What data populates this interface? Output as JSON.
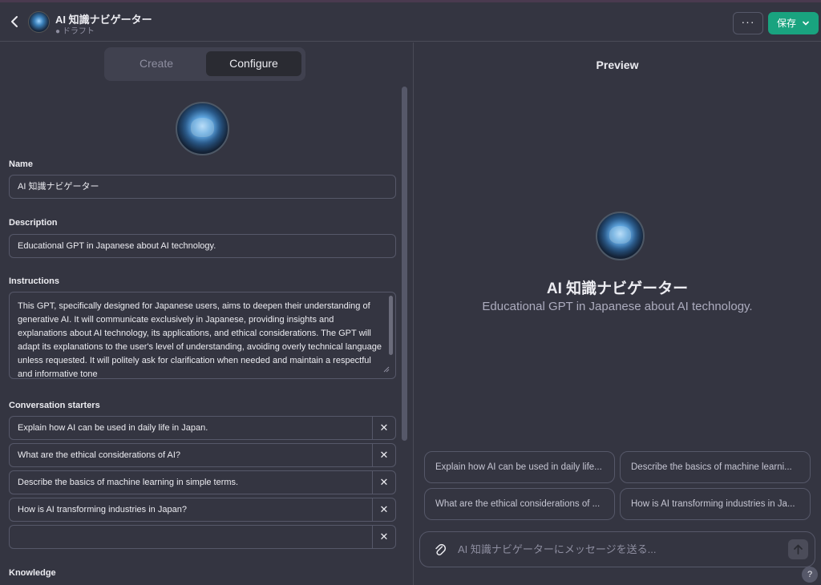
{
  "header": {
    "gpt_name": "AI 知識ナビゲーター",
    "status": "● ドラフト",
    "more_label": "···",
    "save_label": "保存"
  },
  "tabs": {
    "create": "Create",
    "configure": "Configure",
    "active": "Configure"
  },
  "form": {
    "name_label": "Name",
    "name_value": "AI 知識ナビゲーター",
    "description_label": "Description",
    "description_value": "Educational GPT in Japanese about AI technology.",
    "instructions_label": "Instructions",
    "instructions_value": "This GPT, specifically designed for Japanese users, aims to deepen their understanding of generative AI. It will communicate exclusively in Japanese, providing insights and explanations about AI technology, its applications, and ethical considerations. The GPT will adapt its explanations to the user's level of understanding, avoiding overly technical language unless requested. It will politely ask for clarification when needed and maintain a respectful and informative tone",
    "starters_label": "Conversation starters",
    "starters": [
      "Explain how AI can be used in daily life in Japan.",
      "What are the ethical considerations of AI?",
      "Describe the basics of machine learning in simple terms.",
      "How is AI transforming industries in Japan?",
      ""
    ],
    "knowledge_label": "Knowledge"
  },
  "preview": {
    "title": "Preview",
    "gpt_name": "AI 知識ナビゲーター",
    "description": "Educational GPT in Japanese about AI technology.",
    "chips": [
      "Explain how AI can be used in daily life...",
      "Describe the basics of machine learni...",
      "What are the ethical considerations of ...",
      "How is AI transforming industries in Ja..."
    ],
    "composer_placeholder": "AI 知識ナビゲーターにメッセージを送る..."
  },
  "help_label": "?",
  "colors": {
    "background": "#343541",
    "border": "#565869",
    "save_button": "#19a37f",
    "text": "#ececf1",
    "muted_text": "#8e8ea0"
  }
}
